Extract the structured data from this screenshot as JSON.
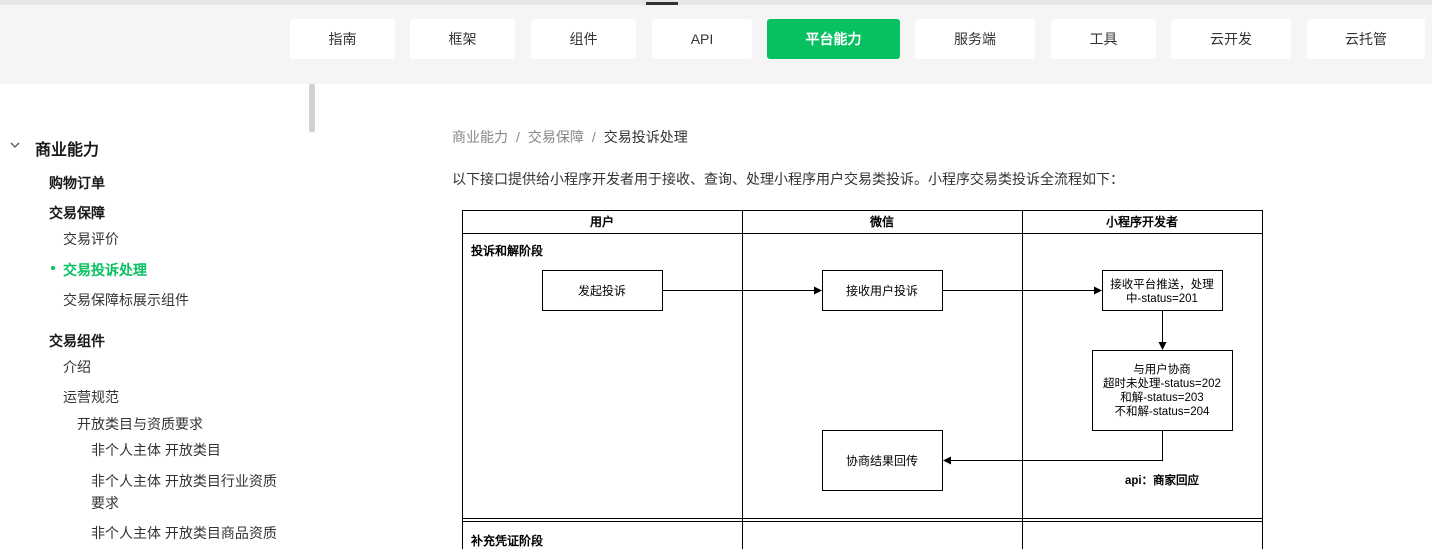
{
  "nav": {
    "tabs": [
      {
        "label": "指南"
      },
      {
        "label": "框架"
      },
      {
        "label": "组件"
      },
      {
        "label": "API"
      },
      {
        "label": "平台能力"
      },
      {
        "label": "服务端"
      },
      {
        "label": "工具"
      },
      {
        "label": "云开发"
      },
      {
        "label": "云托管"
      }
    ],
    "active_tab": "平台能力",
    "accent_color": "#07c160"
  },
  "sidebar": {
    "section": "商业能力",
    "items": [
      {
        "label": "购物订单"
      },
      {
        "label": "交易保障"
      },
      {
        "label": "交易评价"
      },
      {
        "label": "交易投诉处理"
      },
      {
        "label": "交易保障标展示组件"
      },
      {
        "label": "交易组件"
      },
      {
        "label": "介绍"
      },
      {
        "label": "运营规范"
      },
      {
        "label": "开放类目与资质要求"
      },
      {
        "label": "非个人主体 开放类目"
      },
      {
        "label": "非个人主体 开放类目行业资质"
      },
      {
        "label": "要求"
      },
      {
        "label": "非个人主体 开放类目商品资质"
      }
    ]
  },
  "breadcrumb": {
    "items": [
      "商业能力",
      "交易保障",
      "交易投诉处理"
    ],
    "separator": "/"
  },
  "intro": "以下接口提供给小程序开发者用于接收、查询、处理小程序用户交易类投诉。小程序交易类投诉全流程如下：",
  "diagram": {
    "lanes": [
      "用户",
      "微信",
      "小程序开发者"
    ],
    "stage1": "投诉和解阶段",
    "stage2": "补充凭证阶段",
    "boxes": {
      "user_complaint": "发起投诉",
      "wechat_receive": "接收用户投诉",
      "dev_receive_1": "接收平台推送，处理",
      "dev_receive_2": "中-status=201",
      "negotiate_1": "与用户协商",
      "negotiate_2": "超时未处理-status=202",
      "negotiate_3": "和解-status=203",
      "negotiate_4": "不和解-status=204",
      "result_return": "协商结果回传"
    },
    "api_note": "api：商家回应"
  }
}
